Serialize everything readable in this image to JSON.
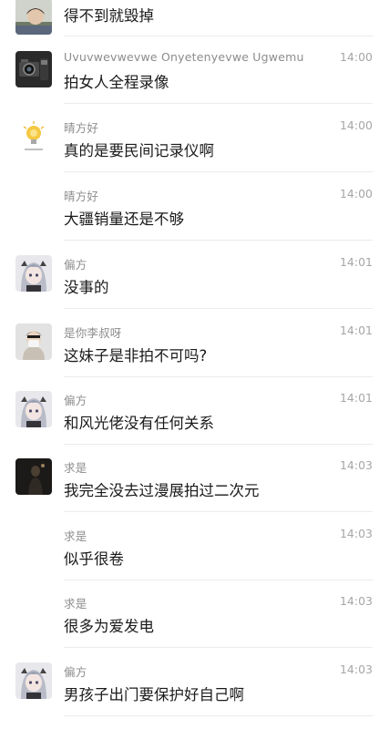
{
  "messages": [
    {
      "name": "",
      "time": "",
      "text": "得不到就毁掉",
      "avatar": "person-photo"
    },
    {
      "name": "Uvuvwevwevwe Onyetenyevwe Ugwemu",
      "time": "14:00",
      "text": "拍女人全程录像",
      "avatar": "camera-gear"
    },
    {
      "name": "晴方好",
      "time": "14:00",
      "text": "真的是要民间记录仪啊",
      "avatar": "lightbulb"
    },
    {
      "name": "晴方好",
      "time": "14:00",
      "text": "大疆销量还是不够",
      "avatar": ""
    },
    {
      "name": "偏方",
      "time": "14:01",
      "text": "没事的",
      "avatar": "anime-girl"
    },
    {
      "name": "是你李叔呀",
      "time": "14:01",
      "text": "这妹子是非拍不可吗?",
      "avatar": "masked-person"
    },
    {
      "name": "偏方",
      "time": "14:01",
      "text": "和风光佬没有任何关系",
      "avatar": "anime-girl"
    },
    {
      "name": "求是",
      "time": "14:03",
      "text": "我完全没去过漫展拍过二次元",
      "avatar": "dark-figure"
    },
    {
      "name": "求是",
      "time": "14:03",
      "text": "似乎很卷",
      "avatar": ""
    },
    {
      "name": "求是",
      "time": "14:03",
      "text": "很多为爱发电",
      "avatar": ""
    },
    {
      "name": "偏方",
      "time": "14:03",
      "text": "男孩子出门要保护好自己啊",
      "avatar": "anime-girl"
    }
  ]
}
